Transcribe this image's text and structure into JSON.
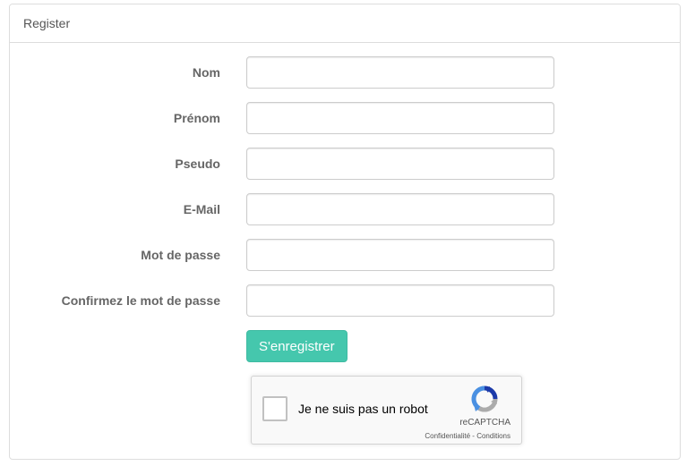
{
  "panel": {
    "title": "Register"
  },
  "form": {
    "fields": [
      {
        "label": "Nom",
        "value": ""
      },
      {
        "label": "Prénom",
        "value": ""
      },
      {
        "label": "Pseudo",
        "value": ""
      },
      {
        "label": "E-Mail",
        "value": ""
      },
      {
        "label": "Mot de passe",
        "value": ""
      },
      {
        "label": "Confirmez le mot de passe",
        "value": ""
      }
    ],
    "submit_label": "S'enregistrer"
  },
  "recaptcha": {
    "label": "Je ne suis pas un robot",
    "brand": "reCAPTCHA",
    "privacy": "Confidentialité",
    "separator": " - ",
    "terms": "Conditions",
    "logo_icon": "recaptcha-logo-icon",
    "checked": false
  },
  "colors": {
    "accent": "#45c7ad",
    "recaptcha_blue": "#4a90e2",
    "recaptcha_dark_blue": "#1c3aa9",
    "recaptcha_gray": "#ababab"
  }
}
